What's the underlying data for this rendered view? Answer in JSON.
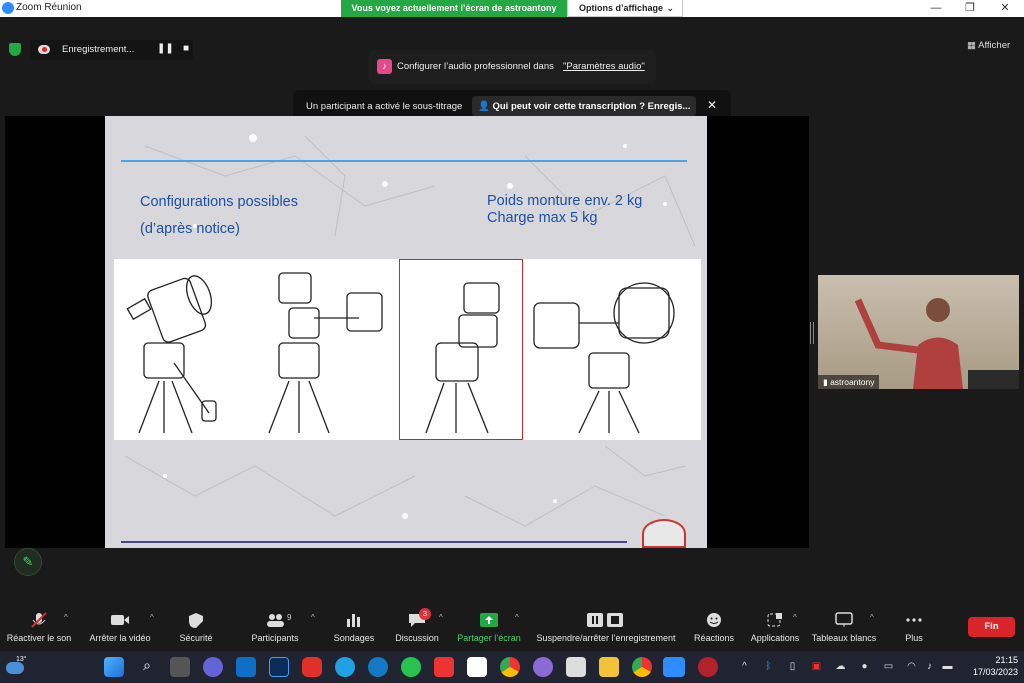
{
  "window": {
    "title": "Zoom Réunion",
    "share_notice": "Vous voyez actuellement l’écran de astroantony",
    "view_options": "Options d’affichage"
  },
  "recording": {
    "label": "Enregistrement..."
  },
  "view_button": "Afficher",
  "audio_banner": {
    "text": "Configurer l’audio professionnel dans",
    "link": "\"Paramètres audio\""
  },
  "caption_banner": {
    "text": "Un participant a activé le sous-titrage",
    "button": "Qui peut voir cette transcription ? Enregis..."
  },
  "slide": {
    "left_title_line1": "Configurations possibles",
    "left_title_line2": "(d’après notice)",
    "right_line1": "Poids monture env. 2 kg",
    "right_line2": "Charge max 5 kg"
  },
  "participant": {
    "name": "astroantony"
  },
  "toolbar": {
    "unmute": "Réactiver le son",
    "stop_video": "Arrêter la vidéo",
    "security": "Sécurité",
    "participants": "Participants",
    "participants_count": "9",
    "polls": "Sondages",
    "chat": "Discussion",
    "chat_badge": "3",
    "share": "Partager l’écran",
    "pause_record": "Suspendre/arrêter l’enregistrement",
    "reactions": "Réactions",
    "apps": "Applications",
    "whiteboards": "Tableaux blancs",
    "more": "Plus",
    "end": "Fin"
  },
  "taskbar": {
    "weather": "13°",
    "time": "21:15",
    "date": "17/03/2023"
  },
  "colors": {
    "share_green": "#23a844",
    "end_red": "#d9242a",
    "slide_blue": "#1d4fa3"
  }
}
